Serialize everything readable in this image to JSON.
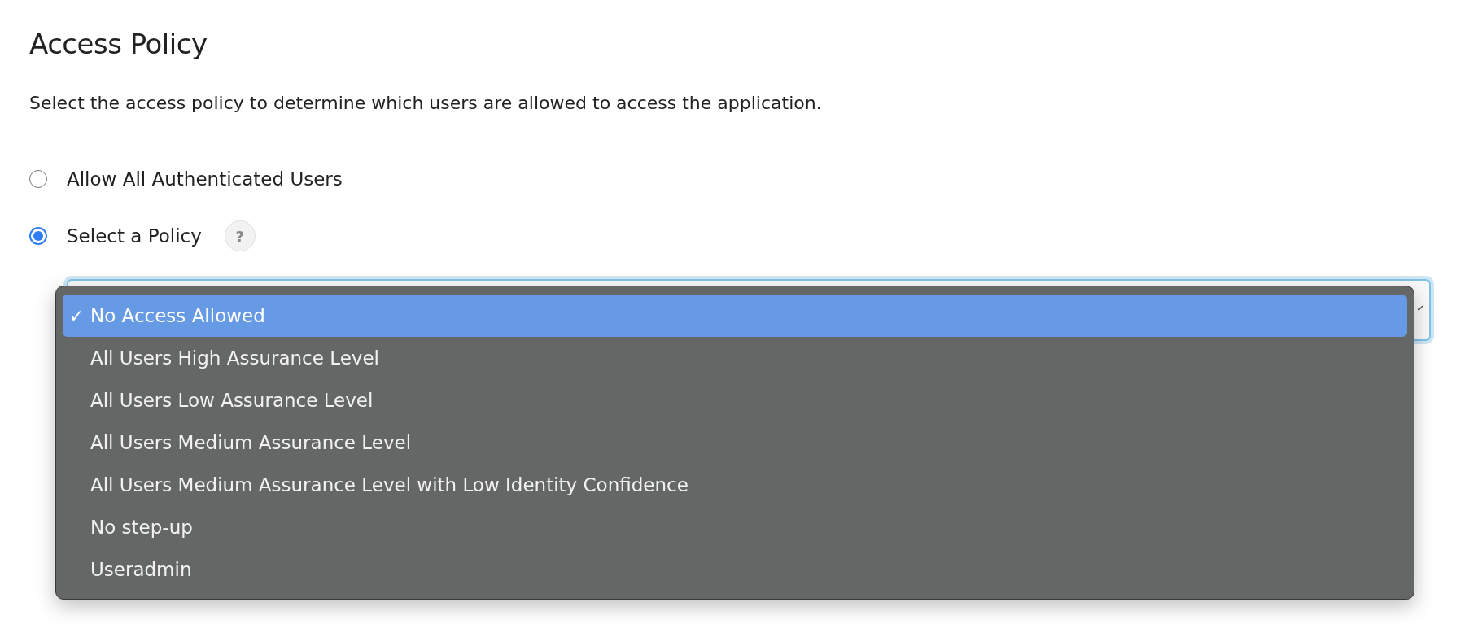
{
  "title": "Access Policy",
  "description": "Select the access policy to determine which users are allowed to access the application.",
  "options": [
    {
      "label": "Allow All Authenticated Users",
      "selected": false
    },
    {
      "label": "Select a Policy",
      "selected": true,
      "help_icon": "?"
    }
  ],
  "policy_menu": {
    "check_mark": "✓",
    "items": [
      {
        "label": "No Access Allowed",
        "selected": true
      },
      {
        "label": "All Users High Assurance Level",
        "selected": false
      },
      {
        "label": "All Users Low Assurance Level",
        "selected": false
      },
      {
        "label": "All Users Medium Assurance Level",
        "selected": false
      },
      {
        "label": "All Users Medium Assurance Level with Low Identity Confidence",
        "selected": false
      },
      {
        "label": "No step-up",
        "selected": false
      },
      {
        "label": "Useradmin",
        "selected": false
      }
    ]
  }
}
